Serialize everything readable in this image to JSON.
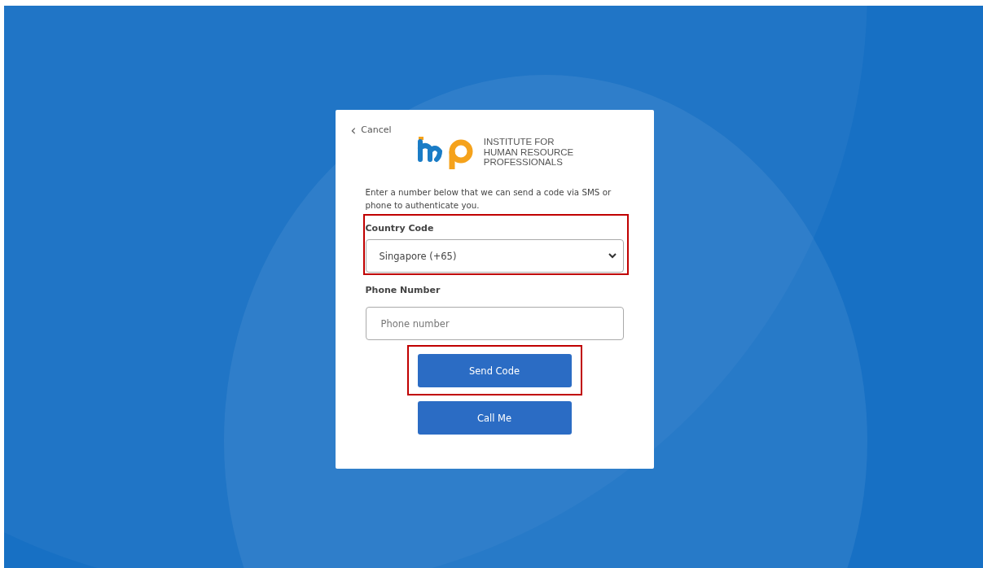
{
  "cancel": {
    "icon": "‹",
    "label": "Cancel"
  },
  "logo": {
    "lines": [
      "INSTITUTE FOR",
      "HUMAN RESOURCE",
      "PROFESSIONALS"
    ]
  },
  "intro": "Enter a number below that we can send a code via SMS or phone to authenticate you.",
  "country_code": {
    "label": "Country Code",
    "value": "Singapore (+65)",
    "highlighted": true
  },
  "phone_number": {
    "label": "Phone Number",
    "placeholder": "Phone number",
    "highlighted": false
  },
  "buttons": [
    {
      "label": "Send Code",
      "highlighted": true
    },
    {
      "label": "Call Me",
      "highlighted": false
    }
  ]
}
